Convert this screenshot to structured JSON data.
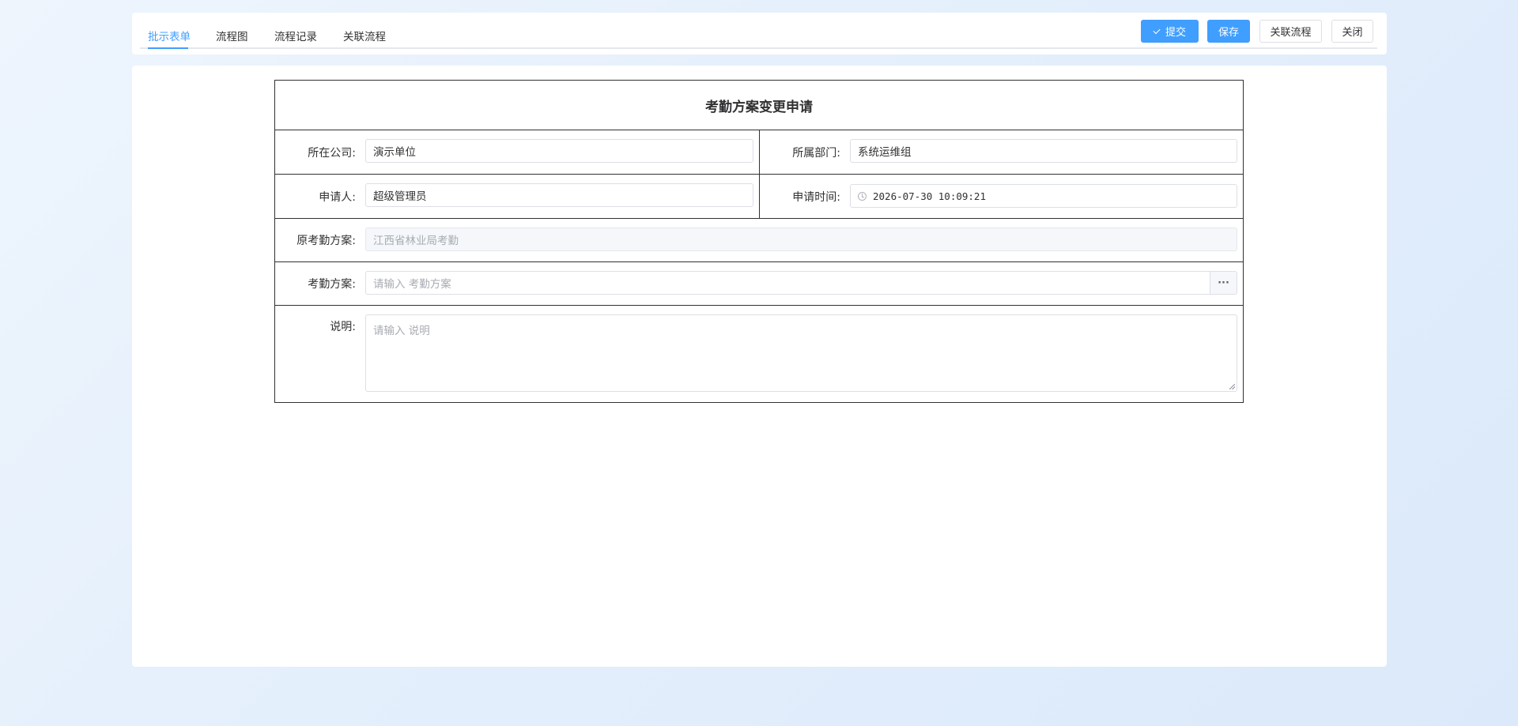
{
  "tabs": [
    {
      "label": "批示表单",
      "active": true
    },
    {
      "label": "流程图",
      "active": false
    },
    {
      "label": "流程记录",
      "active": false
    },
    {
      "label": "关联流程",
      "active": false
    }
  ],
  "toolbar": {
    "submit_label": "提交",
    "save_label": "保存",
    "related_label": "关联流程",
    "close_label": "关闭",
    "submit_icon": "check-icon"
  },
  "form": {
    "title": "考勤方案变更申请",
    "company": {
      "label": "所在公司:",
      "value": "演示单位"
    },
    "department": {
      "label": "所属部门:",
      "value": "系统运维组"
    },
    "applicant": {
      "label": "申请人:",
      "value": "超级管理员"
    },
    "apply_time": {
      "label": "申请时间:",
      "value": "2026-07-30 10:09:21",
      "icon": "clock-icon"
    },
    "original_plan": {
      "label": "原考勤方案:",
      "value": "江西省林业局考勤",
      "disabled": true
    },
    "plan": {
      "label": "考勤方案:",
      "placeholder": "请输入 考勤方案",
      "more_label": "···"
    },
    "description": {
      "label": "说明:",
      "placeholder": "请输入 说明"
    }
  },
  "colors": {
    "primary": "#409eff",
    "border": "#303133",
    "input_border": "#dcdfe6",
    "placeholder": "#a8abb2",
    "disabled_bg": "#f5f7fa"
  }
}
